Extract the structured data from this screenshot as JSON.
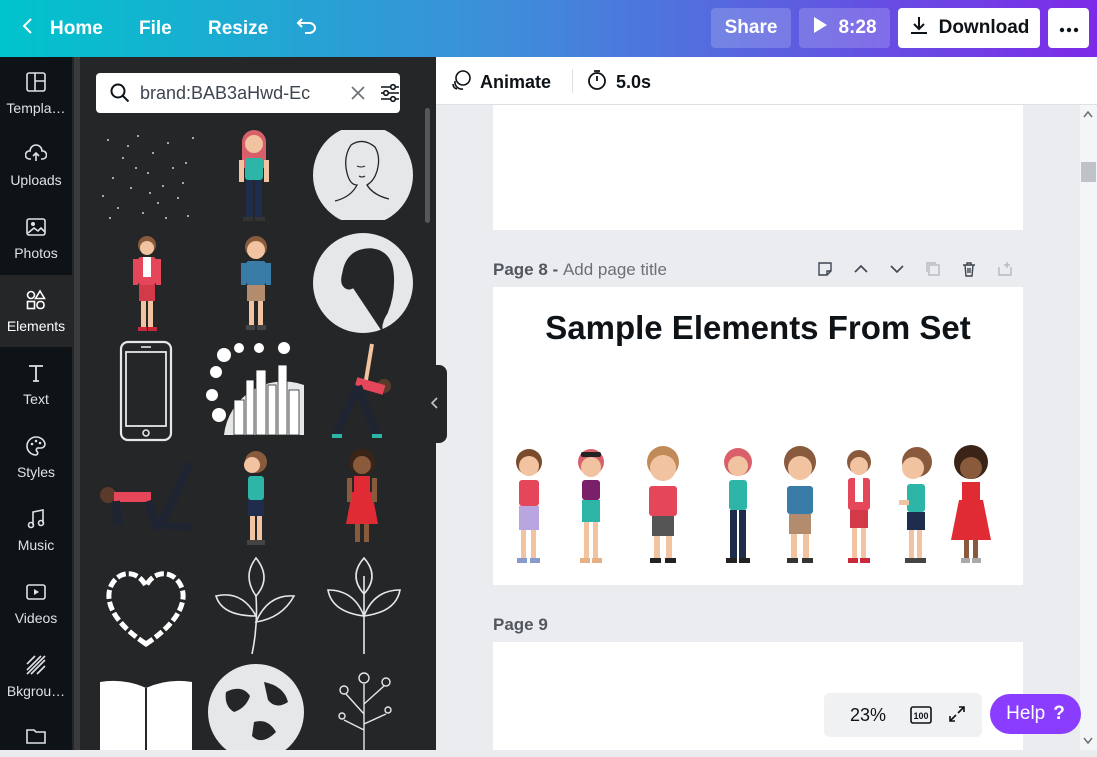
{
  "topbar": {
    "home": "Home",
    "file": "File",
    "resize": "Resize",
    "share": "Share",
    "play_time": "8:28",
    "download": "Download"
  },
  "rail": {
    "items": [
      {
        "label": "Templa…",
        "icon": "template-icon"
      },
      {
        "label": "Uploads",
        "icon": "upload-icon"
      },
      {
        "label": "Photos",
        "icon": "photo-icon"
      },
      {
        "label": "Elements",
        "icon": "shapes-icon"
      },
      {
        "label": "Text",
        "icon": "text-icon"
      },
      {
        "label": "Styles",
        "icon": "palette-icon"
      },
      {
        "label": "Music",
        "icon": "music-icon"
      },
      {
        "label": "Videos",
        "icon": "video-icon"
      },
      {
        "label": "Bkgrou…",
        "icon": "background-icon"
      }
    ]
  },
  "panel": {
    "search_value": "brand:BAB3aHwd-Ec"
  },
  "editor": {
    "animate": "Animate",
    "duration": "5.0s"
  },
  "pages": {
    "page8_label": "Page 8 -",
    "page8_title_placeholder": "Add page title",
    "page8_heading": "Sample Elements From Set",
    "page9_label": "Page 9"
  },
  "zoom": {
    "level": "23%",
    "fit": "100"
  },
  "help": {
    "label": "Help",
    "mark": "?"
  },
  "colors": {
    "accent_purple": "#8b3dff",
    "topbar_start": "#00c4cc",
    "topbar_end": "#7d2ae8"
  }
}
